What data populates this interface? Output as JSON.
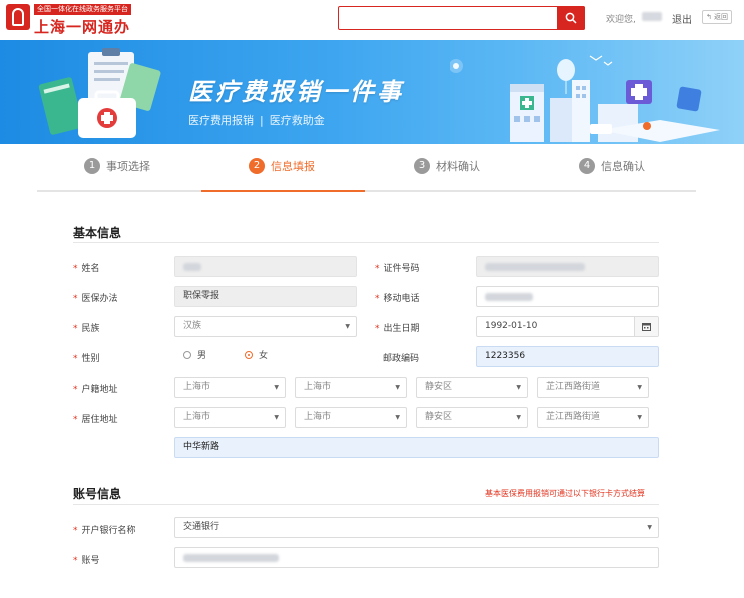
{
  "header": {
    "logo_small": "全国一体化在线政务服务平台",
    "logo_big": "上海一网通办",
    "search_placeholder": "",
    "welcome": "欢迎您,",
    "logout": "退出",
    "back": "↰ 返回"
  },
  "banner": {
    "title": "医疗费报销一件事",
    "sub_left": "医疗费用报销",
    "sub_sep": "|",
    "sub_right": "医疗救助金"
  },
  "steps": [
    {
      "num": "1",
      "label": "事项选择",
      "active": false
    },
    {
      "num": "2",
      "label": "信息填报",
      "active": true
    },
    {
      "num": "3",
      "label": "材料确认",
      "active": false
    },
    {
      "num": "4",
      "label": "信息确认",
      "active": false
    }
  ],
  "basic": {
    "title": "基本信息",
    "name_label": "姓名",
    "id_label": "证件号码",
    "insurance_label": "医保办法",
    "insurance_value": "职保零报",
    "mobile_label": "移动电话",
    "ethnic_label": "民族",
    "ethnic_value": "汉族",
    "birth_label": "出生日期",
    "birth_value": "1992-01-10",
    "gender_label": "性别",
    "gender_male": "男",
    "gender_female": "女",
    "postcode_label": "邮政编码",
    "postcode_value": "1223356",
    "hukou_label": "户籍地址",
    "hukou": [
      "上海市",
      "上海市",
      "静安区",
      "芷江西路街道"
    ],
    "residence_label": "居住地址",
    "residence": [
      "上海市",
      "上海市",
      "静安区",
      "芷江西路街道"
    ],
    "residence_detail": "中华新路"
  },
  "account": {
    "title": "账号信息",
    "notice": "基本医保费用报销可通过以下银行卡方式结算",
    "bank_label": "开户银行名称",
    "bank_value": "交通银行",
    "account_label": "账号"
  },
  "colors": {
    "brand_red": "#d7261f",
    "accent_orange": "#ef6c2b",
    "banner_blue": "#1d8be3"
  }
}
